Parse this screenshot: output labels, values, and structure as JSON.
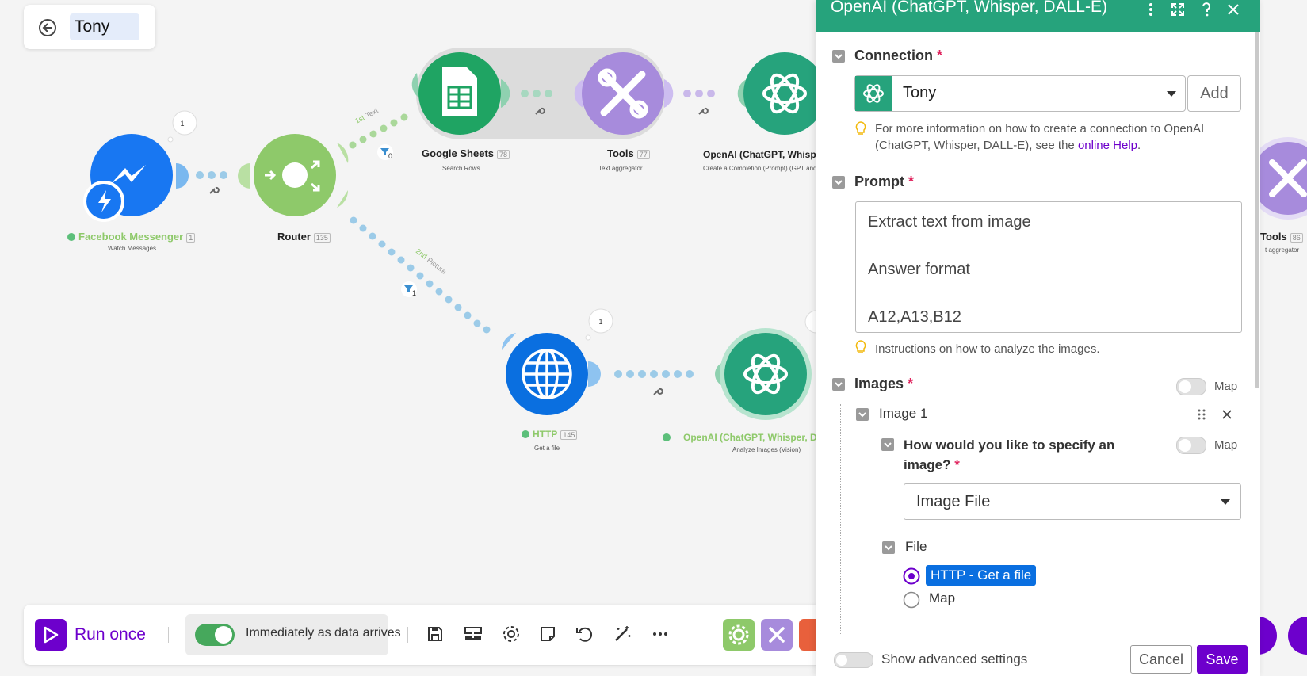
{
  "scenario": {
    "name": "Tony"
  },
  "canvas": {
    "modules": {
      "messenger": {
        "title": "Facebook Messenger",
        "id": "1",
        "subtitle": "Watch Messages",
        "badge": "1"
      },
      "router": {
        "title": "Router",
        "id": "135"
      },
      "sheets": {
        "title": "Google Sheets",
        "id": "78",
        "subtitle": "Search Rows"
      },
      "tools1": {
        "title": "Tools",
        "id": "77",
        "subtitle": "Text aggregator"
      },
      "openai1": {
        "title": "OpenAI (ChatGPT, Whisp",
        "subtitle": "Create a Completion (Prompt) (GPT and"
      },
      "http": {
        "title": "HTTP",
        "id": "145",
        "subtitle": "Get a file",
        "badge": "1"
      },
      "openai2": {
        "title": "OpenAI (ChatGPT, Whisper, D",
        "subtitle": "Analyze Images (Vision)"
      },
      "tools2": {
        "title": "Tools",
        "id": "86",
        "subtitle": "t aggregator"
      }
    },
    "routes": {
      "route1": {
        "order": "1st",
        "name": "Text",
        "filter_count": "0"
      },
      "route2": {
        "order": "2nd",
        "name": "Picture",
        "filter_count": "1"
      }
    },
    "colors": {
      "messenger": "#1877f2",
      "router": "#8ec96a",
      "sheets": "#1fa463",
      "tools": "#a78bdc",
      "openai": "#26a37c",
      "http": "#0a6fe0"
    }
  },
  "toolbar": {
    "run_once_label": "Run once",
    "schedule_label": "Immediately as data arrives",
    "icons": [
      "save-icon",
      "auto-align-icon",
      "settings-icon",
      "notes-icon",
      "undo-icon",
      "magic-wand-icon",
      "more-icon"
    ]
  },
  "panel": {
    "title": "OpenAI (ChatGPT, Whisper, DALL-E)",
    "connection": {
      "label": "Connection",
      "value": "Tony",
      "add_label": "Add",
      "help_prefix": "For more information on how to create a connection to OpenAI (ChatGPT, Whisper, DALL-E), see the ",
      "help_link": "online Help",
      "help_suffix": "."
    },
    "prompt": {
      "label": "Prompt",
      "line1": "Extract text from image",
      "line2": "Answer format",
      "line3": "A12,A13,B12",
      "help": "Instructions on how to analyze the images."
    },
    "images": {
      "label": "Images",
      "map_label": "Map",
      "item_label": "Image 1",
      "specify_label_1": "How would you like to specify an",
      "specify_label_2": "image?",
      "specify_value": "Image File",
      "file_label": "File",
      "option_selected": "HTTP - Get a file",
      "option_map": "Map"
    },
    "footer": {
      "advanced_label": "Show advanced settings",
      "cancel_label": "Cancel",
      "save_label": "Save"
    }
  }
}
